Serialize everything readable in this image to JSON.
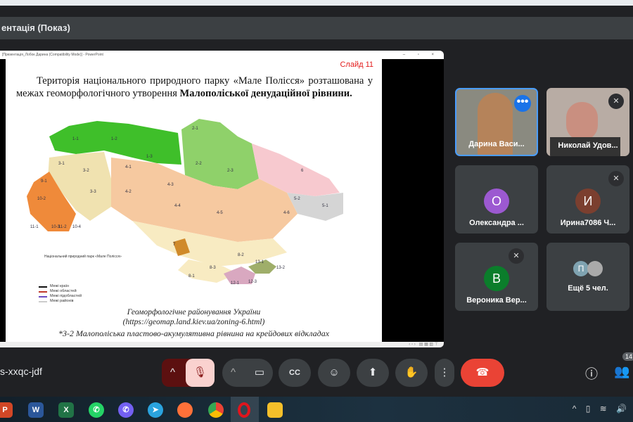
{
  "window": {
    "title": "ентація (Показ)"
  },
  "share": {
    "title": "[Презентація_Лобок Дарина (Compatibility Mode)] - PowerPoint",
    "controls": "– ▫ ×"
  },
  "slide": {
    "number": "Слайд 11",
    "text_1": "Територія національного природного парку «Мале Полісся» розташована у межах геоморфологічного утворення ",
    "text_bold": "Малополіської денудаційної рівнини.",
    "park_label": "Національний природний парк «Мале Полісся»",
    "legend": [
      "Межі країн",
      "Межі областей",
      "Межі підобластей",
      "Межі районів"
    ],
    "legend_colors": [
      "#111111",
      "#c0392b",
      "#6a4cc2",
      "#cccccc"
    ],
    "caption_title": "Геоморфологічне районування України",
    "caption_url": "(https://geomap.land.kiev.ua/zoning-6.html)",
    "footnote": "*3-2    Малополіська пластово-акумулятивна рівнина на крейдових відкладах",
    "map_labels": [
      "1-1",
      "1-2",
      "1-3",
      "2-1",
      "2-2",
      "2-3",
      "3-1",
      "3-2",
      "3-3",
      "4-1",
      "4-2",
      "4-3",
      "4-4",
      "4-5",
      "4-6",
      "5-1",
      "5-2",
      "6",
      "7",
      "8-1",
      "8-2",
      "8-3",
      "9-1",
      "10-2",
      "10-3",
      "10-4",
      "11-1",
      "11-2",
      "12-1",
      "12-3",
      "13-1",
      "13-2"
    ]
  },
  "participants": [
    {
      "name": "Дарина Васи...",
      "type": "video",
      "bg": "#8a8a80"
    },
    {
      "name": "Николай Удов...",
      "type": "video",
      "bg": "#b8aca4",
      "muted": true
    },
    {
      "name": "Олександра ...",
      "initial": "О",
      "color": "#9c59d1"
    },
    {
      "name": "Ирина7086 Ч...",
      "initial": "И",
      "color": "#7b3f2f",
      "muted": true
    },
    {
      "name": "Вероника Вер...",
      "initial": "В",
      "color": "#0b7d2b",
      "muted": true
    },
    {
      "name": "Ещё 5 чел.",
      "initial": "П",
      "color": "#7fa3b1"
    }
  ],
  "meeting": {
    "code": "s-xxqc-jdf",
    "participant_count": "14"
  },
  "taskbar": [
    "PowerPoint",
    "Word",
    "Excel",
    "WhatsApp",
    "Viber",
    "Telegram",
    "Firefox",
    "Chrome",
    "Opera",
    "File Explorer"
  ],
  "colors": {
    "end_call": "#ea4335",
    "accent": "#4285f4",
    "mic_off_bg": "#fad2cf"
  }
}
